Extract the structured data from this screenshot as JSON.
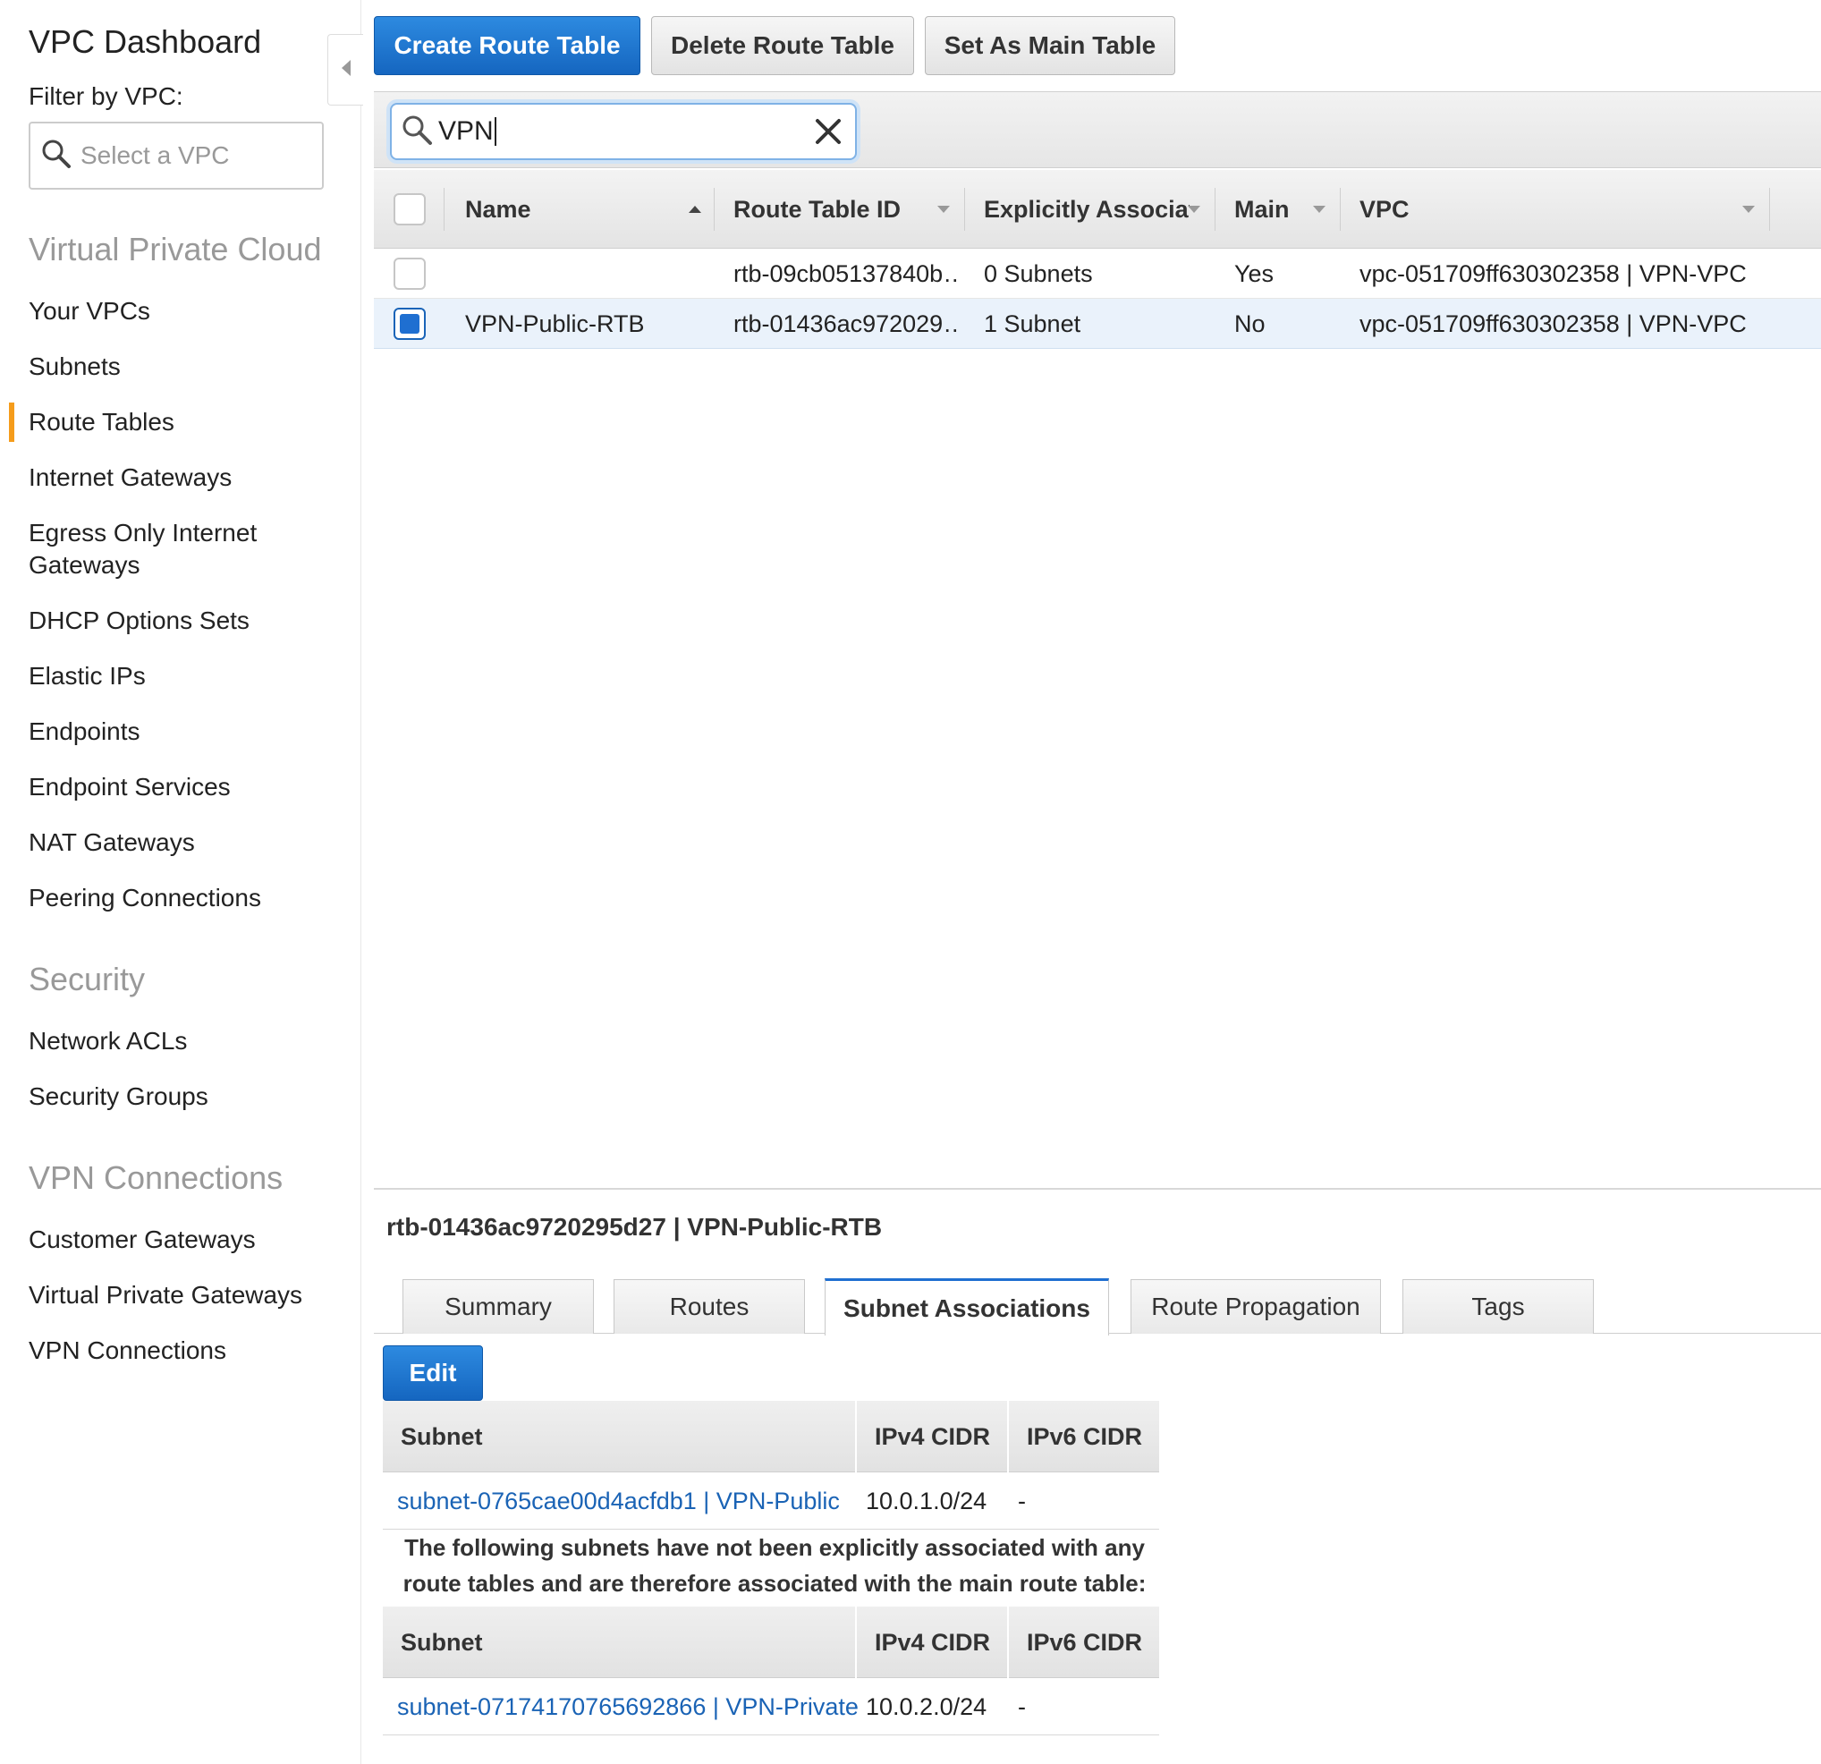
{
  "sidebar": {
    "title": "VPC Dashboard",
    "filter_label": "Filter by VPC:",
    "filter_placeholder": "Select a VPC",
    "sections": {
      "vpc": {
        "heading": "Virtual Private Cloud",
        "items": [
          "Your VPCs",
          "Subnets",
          "Route Tables",
          "Internet Gateways",
          "Egress Only Internet Gateways",
          "DHCP Options Sets",
          "Elastic IPs",
          "Endpoints",
          "Endpoint Services",
          "NAT Gateways",
          "Peering Connections"
        ]
      },
      "security": {
        "heading": "Security",
        "items": [
          "Network ACLs",
          "Security Groups"
        ]
      },
      "vpn": {
        "heading": "VPN Connections",
        "items": [
          "Customer Gateways",
          "Virtual Private Gateways",
          "VPN Connections"
        ]
      }
    },
    "active_item": "Route Tables"
  },
  "toolbar": {
    "create_label": "Create Route Table",
    "delete_label": "Delete Route Table",
    "set_main_label": "Set As Main Table"
  },
  "search": {
    "value": "VPN"
  },
  "table": {
    "columns": [
      "Name",
      "Route Table ID",
      "Explicitly Associat",
      "Main",
      "VPC"
    ],
    "rows": [
      {
        "name": "",
        "id": "rtb-09cb05137840b…",
        "assoc": "0 Subnets",
        "main": "Yes",
        "vpc": "vpc-051709ff630302358 | VPN-VPC",
        "selected": false
      },
      {
        "name": "VPN-Public-RTB",
        "id": "rtb-01436ac972029…",
        "assoc": "1 Subnet",
        "main": "No",
        "vpc": "vpc-051709ff630302358 | VPN-VPC",
        "selected": true
      }
    ]
  },
  "detail": {
    "title": "rtb-01436ac9720295d27 | VPN-Public-RTB",
    "tabs": [
      "Summary",
      "Routes",
      "Subnet Associations",
      "Route Propagation",
      "Tags"
    ],
    "active_tab": "Subnet Associations",
    "edit_label": "Edit",
    "columns": [
      "Subnet",
      "IPv4 CIDR",
      "IPv6 CIDR"
    ],
    "explicit_rows": [
      {
        "subnet": "subnet-0765cae00d4acfdb1 | VPN-Public",
        "ipv4": "10.0.1.0/24",
        "ipv6": "-"
      }
    ],
    "note": "The following subnets have not been explicitly associated with any route tables and are therefore associated with the main route table:",
    "main_rows": [
      {
        "subnet": "subnet-07174170765692866 | VPN-Private",
        "ipv4": "10.0.2.0/24",
        "ipv6": "-"
      }
    ]
  },
  "colors": {
    "primary": "#1f6fd1",
    "active_indicator": "#f59c1b",
    "link": "#1a63b5",
    "selected_row": "#eaf2fb"
  }
}
